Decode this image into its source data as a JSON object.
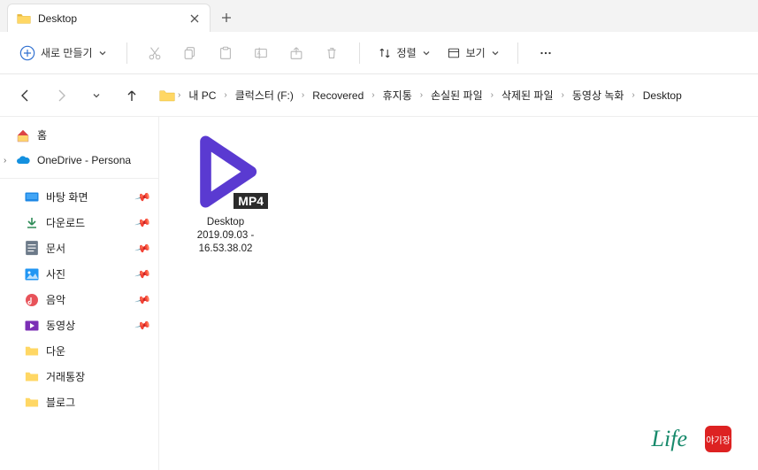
{
  "tab": {
    "title": "Desktop"
  },
  "toolbar": {
    "new_label": "새로 만들기",
    "sort_label": "정렬",
    "view_label": "보기"
  },
  "breadcrumb": [
    "내 PC",
    "클럭스터 (F:)",
    "Recovered",
    "휴지통",
    "손실된 파일",
    "삭제된 파일",
    "동영상 녹화",
    "Desktop"
  ],
  "sidebar": {
    "home": "홈",
    "onedrive": "OneDrive - Persona",
    "quick": [
      {
        "name": "바탕 화면",
        "icon": "desktop"
      },
      {
        "name": "다운로드",
        "icon": "download"
      },
      {
        "name": "문서",
        "icon": "doc"
      },
      {
        "name": "사진",
        "icon": "pic"
      },
      {
        "name": "음악",
        "icon": "music"
      },
      {
        "name": "동영상",
        "icon": "video"
      },
      {
        "name": "다운",
        "icon": "folder"
      },
      {
        "name": "거래통장",
        "icon": "folder"
      },
      {
        "name": "블로그",
        "icon": "folder"
      }
    ]
  },
  "file": {
    "badge": "MP4",
    "name_l1": "Desktop",
    "name_l2": "2019.09.03 -",
    "name_l3": "16.53.38.02"
  },
  "watermark": {
    "text": "Life",
    "stamp": "야기장"
  }
}
